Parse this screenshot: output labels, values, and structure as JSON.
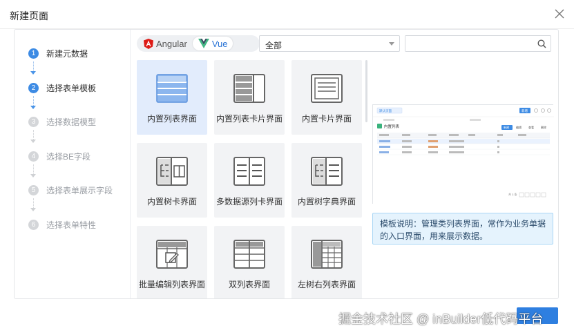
{
  "dialog": {
    "title": "新建页面"
  },
  "steps": [
    {
      "num": "1",
      "label": "新建元数据",
      "state": "done"
    },
    {
      "num": "2",
      "label": "选择表单模板",
      "state": "active"
    },
    {
      "num": "3",
      "label": "选择数据模型",
      "state": "todo"
    },
    {
      "num": "4",
      "label": "选择BE字段",
      "state": "todo"
    },
    {
      "num": "5",
      "label": "选择表单展示字段",
      "state": "todo"
    },
    {
      "num": "6",
      "label": "选择表单特性",
      "state": "todo"
    }
  ],
  "framework": {
    "angular": "Angular",
    "vue": "Vue",
    "selected": "Vue"
  },
  "filter": {
    "value": "全部"
  },
  "search": {
    "placeholder": ""
  },
  "templates": [
    {
      "label": "内置列表界面",
      "icon": "list-layout-icon",
      "selected": true
    },
    {
      "label": "内置列表卡片界面",
      "icon": "list-card-layout-icon",
      "selected": false
    },
    {
      "label": "内置卡片界面",
      "icon": "card-layout-icon",
      "selected": false
    },
    {
      "label": "内置树卡界面",
      "icon": "tree-card-layout-icon",
      "selected": false
    },
    {
      "label": "多数据源列卡界面",
      "icon": "multi-source-layout-icon",
      "selected": false
    },
    {
      "label": "内置树字典界面",
      "icon": "tree-dict-layout-icon",
      "selected": false
    },
    {
      "label": "批量编辑列表界面",
      "icon": "batch-edit-layout-icon",
      "selected": false
    },
    {
      "label": "双列表界面",
      "icon": "dual-list-layout-icon",
      "selected": false
    },
    {
      "label": "左树右列表界面",
      "icon": "tree-list-layout-icon",
      "selected": false
    }
  ],
  "preview": {
    "tab": "默认页面",
    "title": "内置列表",
    "primary_button": "新增",
    "buttons": [
      "新建",
      "编辑",
      "查看",
      "删除"
    ],
    "page_info": "共 3 条"
  },
  "description": "模板说明：管理类列表界面，常作为业务单据的入口界面，用来展示数据。",
  "watermark": "掘金技术社区 @ inBuilder低代码平台",
  "colors": {
    "accent": "#3d8be4",
    "selected_card": "#e2ecfc",
    "info_bg": "#e5f3fd"
  }
}
